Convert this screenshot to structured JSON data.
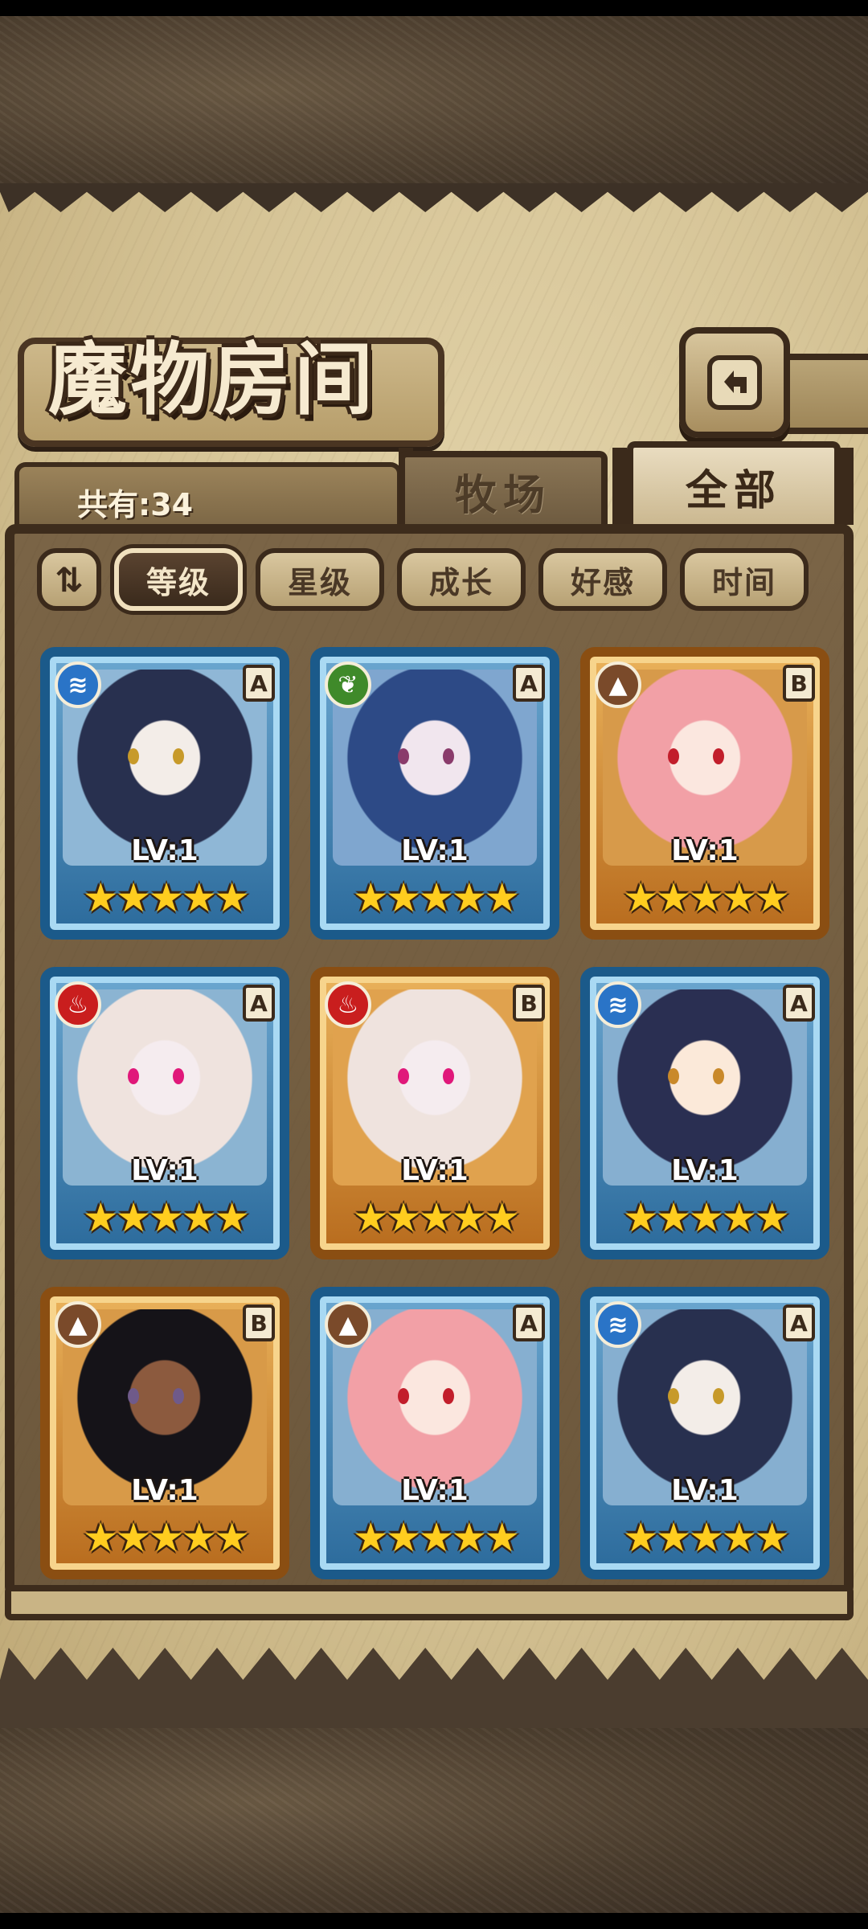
{
  "title": "魔物房间",
  "count_label": "共有:34",
  "tabs": {
    "ranch": "牧场",
    "all": "全部"
  },
  "sort": {
    "toggle_icon": "sort-toggle-icon",
    "buttons": [
      "等级",
      "星级",
      "成长",
      "好感",
      "时间"
    ],
    "active": "等级"
  },
  "icons": {
    "back": "return-arrow-icon"
  },
  "colors": {
    "water": "#2a74c7",
    "nature": "#3f8a2a",
    "fire": "#c91e1e",
    "earth": "#7a4a2a",
    "frame_blue": "#1b5a8a",
    "frame_gold": "#b86c1e",
    "star": "#ffcd1f"
  },
  "monsters": [
    {
      "element": "water",
      "element_glyph": "≋",
      "grade": "A",
      "frame": "blue",
      "level": "LV:1",
      "stars": 5
    },
    {
      "element": "nature",
      "element_glyph": "❦",
      "grade": "A",
      "frame": "blue",
      "level": "LV:1",
      "stars": 5
    },
    {
      "element": "earth",
      "element_glyph": "▲",
      "grade": "B",
      "frame": "gold",
      "level": "LV:1",
      "stars": 5
    },
    {
      "element": "fire",
      "element_glyph": "♨",
      "grade": "A",
      "frame": "blue",
      "level": "LV:1",
      "stars": 5
    },
    {
      "element": "fire",
      "element_glyph": "♨",
      "grade": "B",
      "frame": "gold",
      "level": "LV:1",
      "stars": 5
    },
    {
      "element": "water",
      "element_glyph": "≋",
      "grade": "A",
      "frame": "blue",
      "level": "LV:1",
      "stars": 5
    },
    {
      "element": "earth",
      "element_glyph": "▲",
      "grade": "B",
      "frame": "gold",
      "level": "LV:1",
      "stars": 5
    },
    {
      "element": "earth",
      "element_glyph": "▲",
      "grade": "A",
      "frame": "blue",
      "level": "LV:1",
      "stars": 5
    },
    {
      "element": "water",
      "element_glyph": "≋",
      "grade": "A",
      "frame": "blue",
      "level": "LV:1",
      "stars": 5
    }
  ]
}
